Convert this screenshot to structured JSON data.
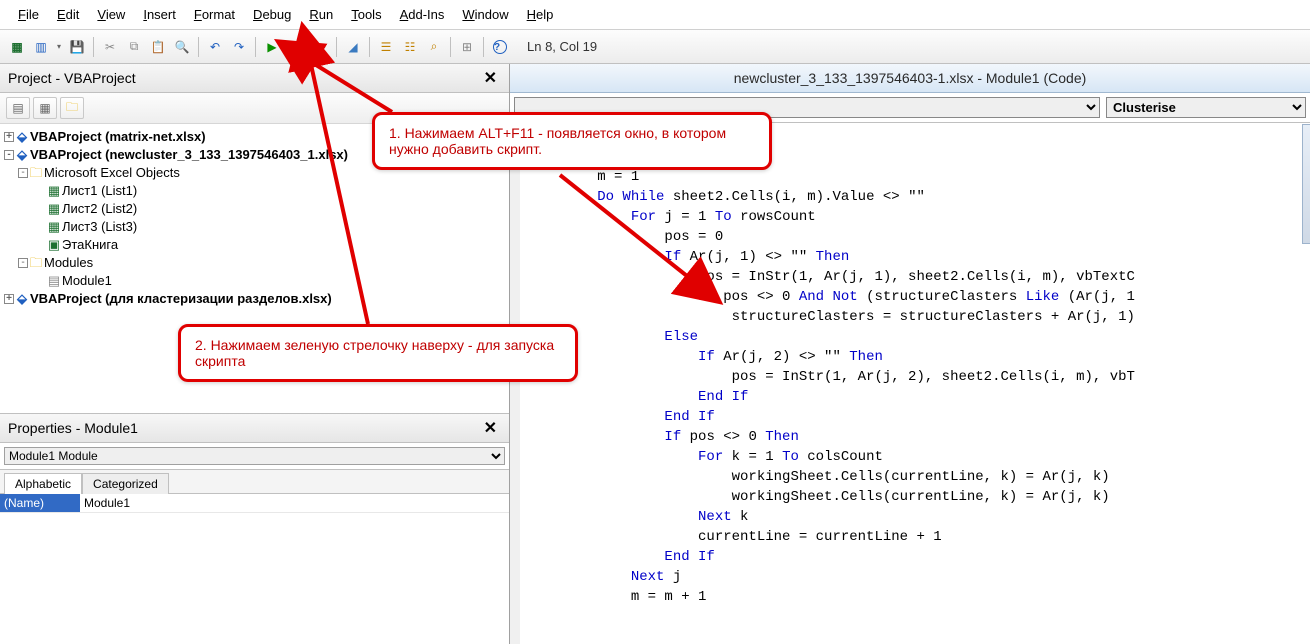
{
  "menu": {
    "items": [
      {
        "label": "File",
        "ul": "F"
      },
      {
        "label": "Edit",
        "ul": "E"
      },
      {
        "label": "View",
        "ul": "V"
      },
      {
        "label": "Insert",
        "ul": "I"
      },
      {
        "label": "Format",
        "ul": "o",
        "rest": "rmat"
      },
      {
        "label": "Debug",
        "ul": "D"
      },
      {
        "label": "Run",
        "ul": "R"
      },
      {
        "label": "Tools",
        "ul": "T"
      },
      {
        "label": "Add-Ins",
        "ul": "A"
      },
      {
        "label": "Window",
        "ul": "W"
      },
      {
        "label": "Help",
        "ul": "H"
      }
    ]
  },
  "toolbar": {
    "cursor_pos": "Ln 8, Col 19"
  },
  "project_pane": {
    "title": "Project - VBAProject",
    "tree": [
      {
        "depth": 0,
        "twisty": "+",
        "icon": "vba",
        "label": "VBAProject (matrix-net.xlsx)",
        "bold": true
      },
      {
        "depth": 0,
        "twisty": "-",
        "icon": "vba",
        "label": "VBAProject (newcluster_3_133_1397546403_1.xlsx)",
        "bold": true
      },
      {
        "depth": 1,
        "twisty": "-",
        "icon": "folder",
        "label": "Microsoft Excel Objects"
      },
      {
        "depth": 2,
        "twisty": "",
        "icon": "sheet",
        "label": "Лист1 (List1)"
      },
      {
        "depth": 2,
        "twisty": "",
        "icon": "sheet",
        "label": "Лист2 (List2)"
      },
      {
        "depth": 2,
        "twisty": "",
        "icon": "sheet",
        "label": "Лист3 (List3)"
      },
      {
        "depth": 2,
        "twisty": "",
        "icon": "wb",
        "label": "ЭтаКнига"
      },
      {
        "depth": 1,
        "twisty": "-",
        "icon": "folder",
        "label": "Modules"
      },
      {
        "depth": 2,
        "twisty": "",
        "icon": "mod",
        "label": "Module1"
      },
      {
        "depth": 0,
        "twisty": "+",
        "icon": "vba",
        "label": "VBAProject (для кластеризации разделов.xlsx)",
        "bold": true
      }
    ]
  },
  "properties_pane": {
    "title": "Properties - Module1",
    "object_label": "Module1 Module",
    "tabs": [
      "Alphabetic",
      "Categorized"
    ],
    "row_name": "(Name)",
    "row_value": "Module1"
  },
  "code_window": {
    "title": "newcluster_3_133_1397546403-1.xlsx - Module1 (Code)",
    "selector_left": "",
    "selector_right": "Clusterise",
    "code_html": "etNum = workingSheetNum + 1\n        currentLine = 1\n        m = 1\n        <span class='kw'>Do While</span> sheet2.Cells(i, m).Value &lt;&gt; \"\"\n            <span class='kw'>For</span> j = 1 <span class='kw'>To</span> rowsCount\n                pos = 0\n                <span class='kw'>If</span> Ar(j, 1) &lt;&gt; \"\" <span class='kw'>Then</span>\n                    pos = InStr(1, Ar(j, 1), sheet2.Cells(i, m), vbTextC\n                    <span class='kw'>If</span> pos &lt;&gt; 0 <span class='kw'>And Not</span> (structureClasters <span class='kw'>Like</span> (Ar(j, 1\n                        structureClasters = structureClasters + Ar(j, 1)\n                <span class='kw'>Else</span>\n                    <span class='kw'>If</span> Ar(j, 2) &lt;&gt; \"\" <span class='kw'>Then</span>\n                        pos = InStr(1, Ar(j, 2), sheet2.Cells(i, m), vbT\n                    <span class='kw'>End If</span>\n                <span class='kw'>End If</span>\n                <span class='kw'>If</span> pos &lt;&gt; 0 <span class='kw'>Then</span>\n                    <span class='kw'>For</span> k = 1 <span class='kw'>To</span> colsCount\n                        workingSheet.Cells(currentLine, k) = Ar(j, k)\n                        workingSheet.Cells(currentLine, k) = Ar(j, k)\n                    <span class='kw'>Next</span> k\n                    currentLine = currentLine + 1\n                <span class='kw'>End If</span>\n            <span class='kw'>Next</span> j\n            m = m + 1"
  },
  "callouts": {
    "c1": "1. Нажимаем ALT+F11  - появляется окно, в котором нужно добавить скрипт.",
    "c2": "2.  Нажимаем зеленую стрелочку наверху - для запуска скрипта"
  }
}
